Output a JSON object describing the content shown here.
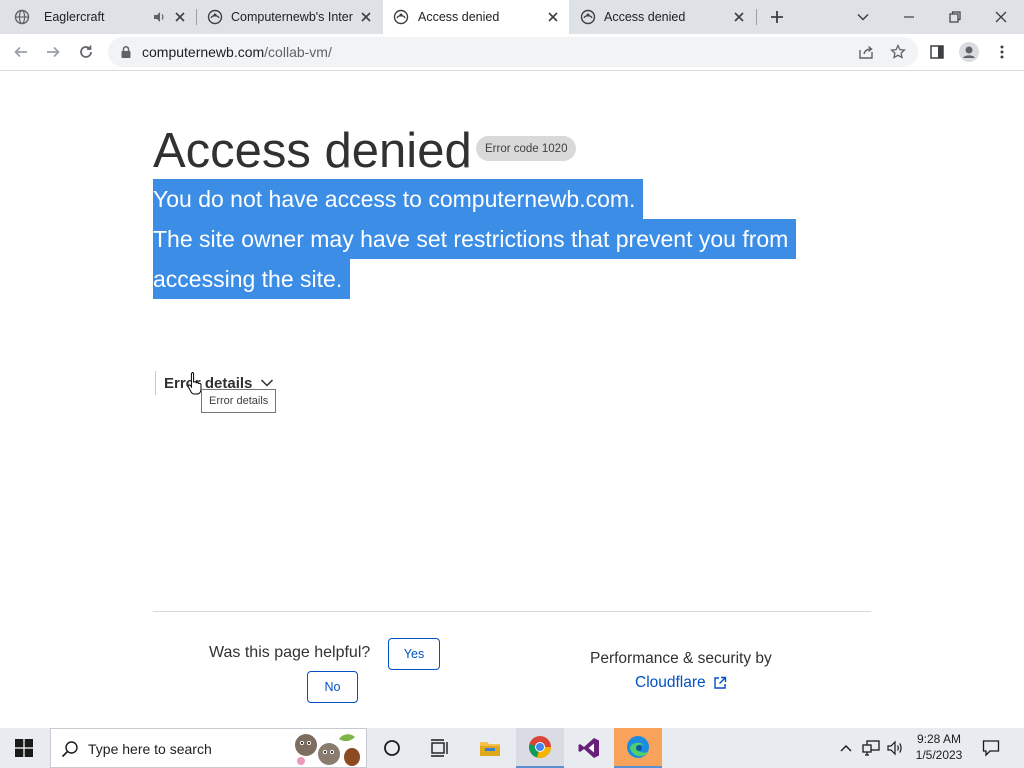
{
  "browser": {
    "tabs": [
      {
        "title": "Eaglercraft",
        "active": false,
        "audio": true
      },
      {
        "title": "Computernewb's Intern",
        "active": false
      },
      {
        "title": "Access denied",
        "active": true
      },
      {
        "title": "Access denied",
        "active": false
      }
    ],
    "new_tab_icon": "plus-icon",
    "url_host": "computernewb.com",
    "url_path": "/collab-vm/"
  },
  "page": {
    "heading": "Access denied",
    "error_badge": "Error code 1020",
    "selected_lines": [
      "You do not have access to computernewb.com.",
      "The site owner may have set restrictions that prevent you from",
      "accessing the site."
    ],
    "details_label": "Error details",
    "tooltip": "Error details",
    "helpful_question": "Was this page helpful?",
    "yes_label": "Yes",
    "no_label": "No",
    "perf_label": "Performance & security by",
    "cloudflare_label": "Cloudflare",
    "selection_color": "#3b8de6",
    "link_color": "#0051c3"
  },
  "taskbar": {
    "search_placeholder": "Type here to search",
    "time": "9:28 AM",
    "date": "1/5/2023"
  }
}
